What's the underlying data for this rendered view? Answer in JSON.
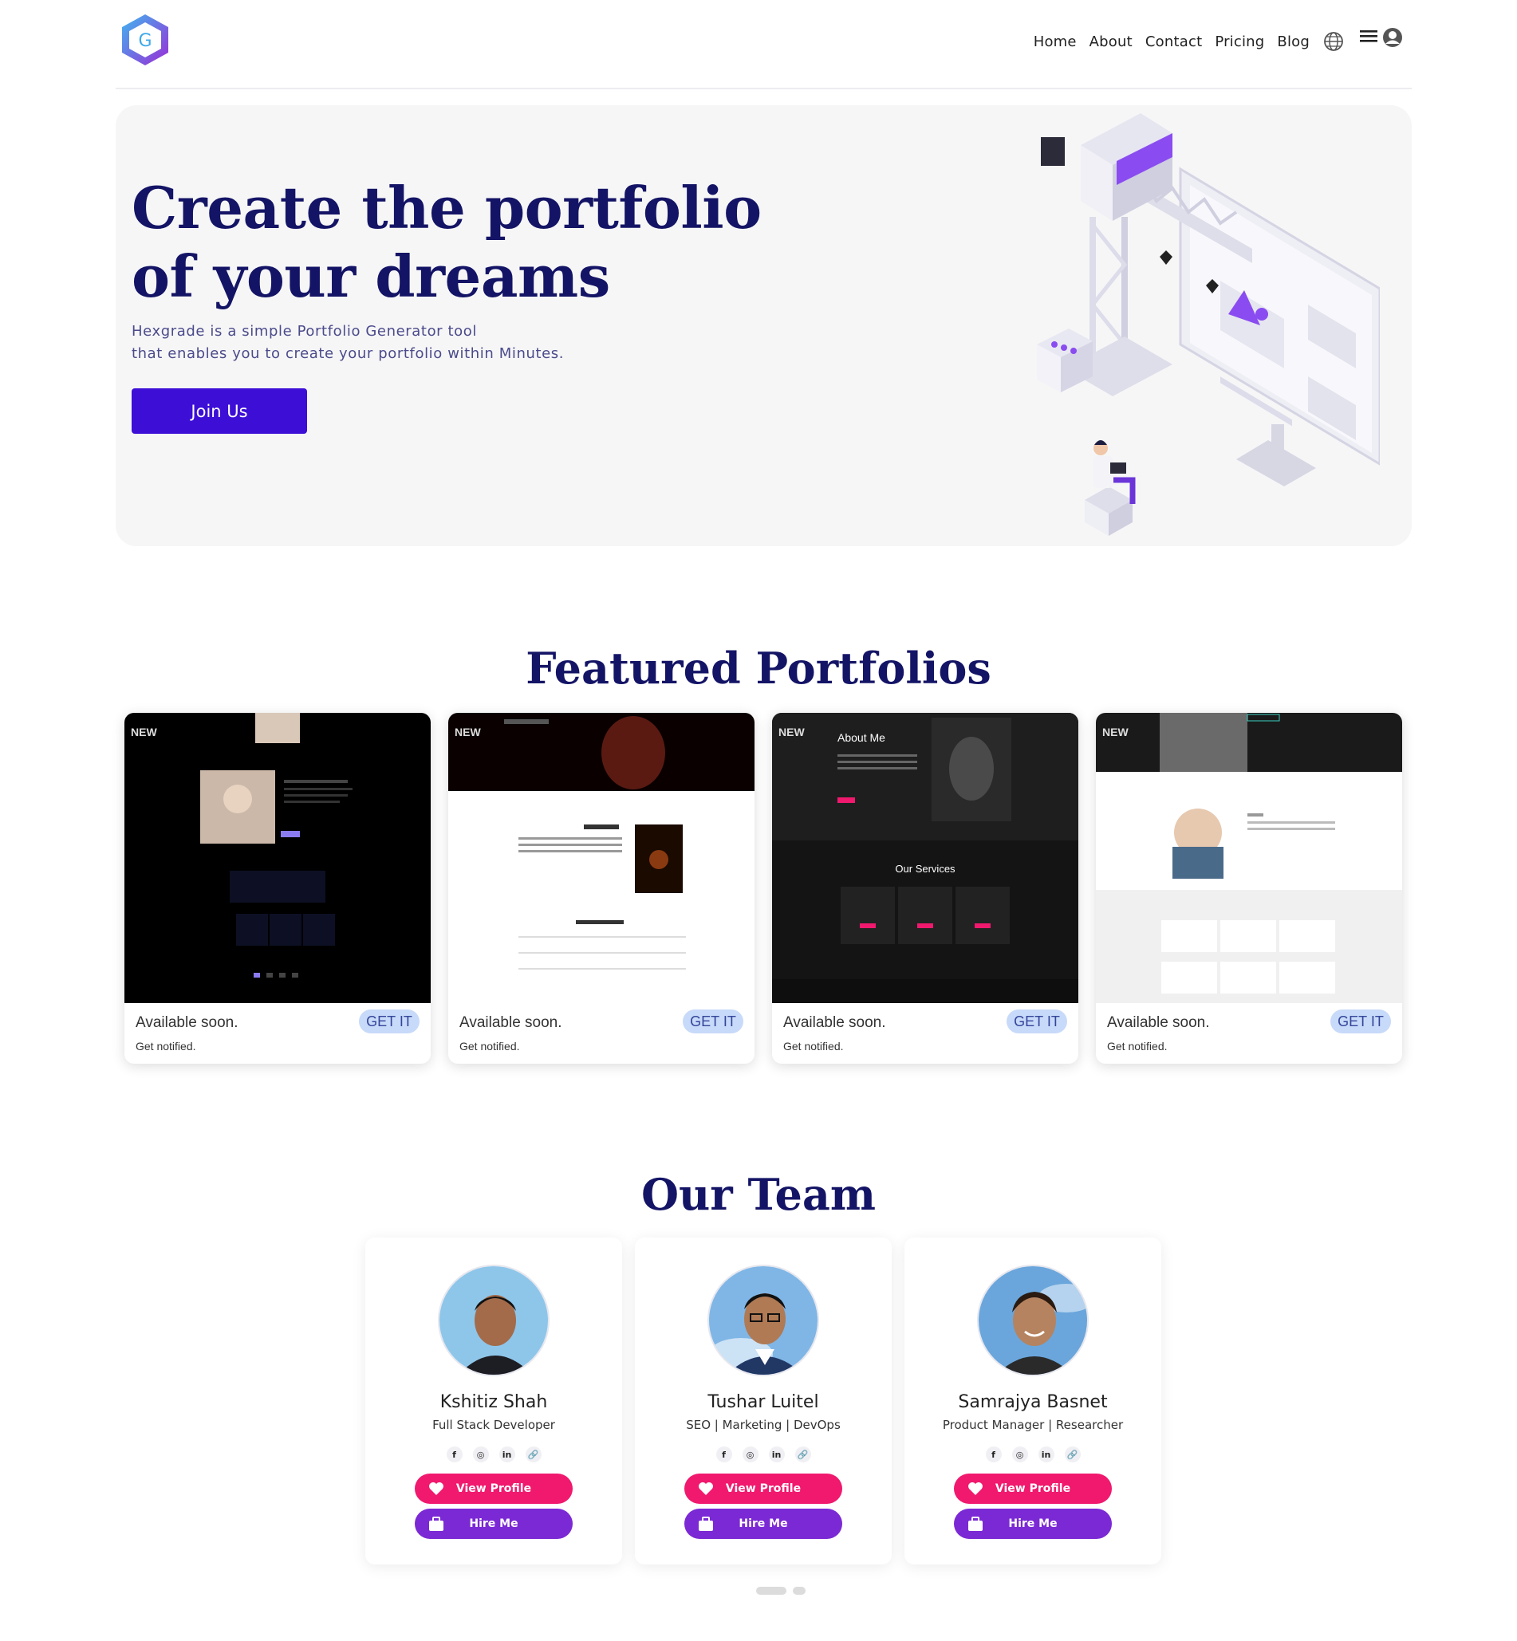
{
  "nav": {
    "logo_letter": "G",
    "items": [
      "Home",
      "About",
      "Contact",
      "Pricing",
      "Blog"
    ],
    "icons": [
      "globe-icon",
      "hamburger-menu-icon",
      "user-icon"
    ]
  },
  "hero": {
    "title_line1": "Create the portfolio",
    "title_line2": "of your dreams",
    "subtitle_line1": "Hexgrade is a simple Portfolio Generator tool",
    "subtitle_line2": "that enables you to create your portfolio within Minutes.",
    "cta_label": "Join Us"
  },
  "featured": {
    "title": "Featured Portfolios",
    "cards": [
      {
        "badge": "NEW",
        "status": "Available soon.",
        "note": "Get notified.",
        "action": "GET IT"
      },
      {
        "badge": "NEW",
        "status": "Available soon.",
        "note": "Get notified.",
        "action": "GET IT"
      },
      {
        "badge": "NEW",
        "status": "Available soon.",
        "note": "Get notified.",
        "action": "GET IT",
        "preview_heading": "About Me",
        "preview_section": "Our Services"
      },
      {
        "badge": "NEW",
        "status": "Available soon.",
        "note": "Get notified.",
        "action": "GET IT"
      }
    ]
  },
  "team": {
    "title": "Our Team",
    "members": [
      {
        "name": "Kshitiz Shah",
        "role": "Full Stack Developer"
      },
      {
        "name": "Tushar Luitel",
        "role": "SEO | Marketing | DevOps"
      },
      {
        "name": "Samrajya Basnet",
        "role": "Product Manager | Researcher"
      }
    ],
    "socials": [
      "f",
      "◎",
      "in",
      "🔗"
    ],
    "view_label": "View Profile",
    "hire_label": "Hire Me"
  },
  "colors": {
    "brand_navy": "#141466",
    "cta_purple": "#3d0fd6",
    "view_pink": "#f0196e",
    "hire_purple": "#7b29d4",
    "get_badge": "#c8daf9"
  }
}
